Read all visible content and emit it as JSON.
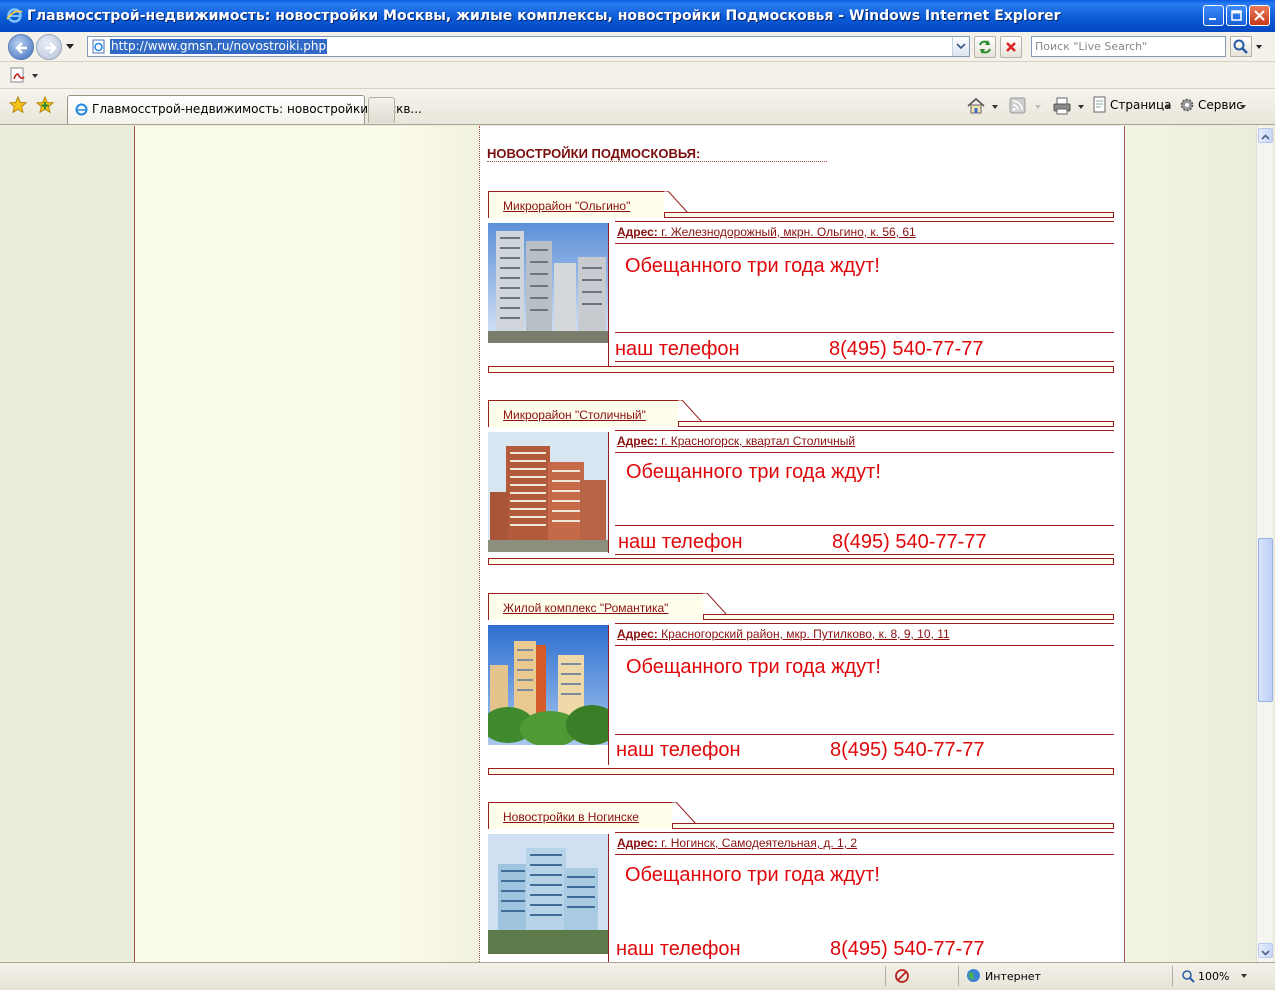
{
  "window": {
    "title": "Главмосстрой-недвижимость: новостройки Москвы, жилые комплексы, новостройки Подмосковья - Windows Internet Explorer"
  },
  "address_bar": {
    "url": "http://www.gmsn.ru/novostroiki.php"
  },
  "search": {
    "placeholder": "Поиск \"Live Search\""
  },
  "tabs": [
    {
      "label": "Главмосстрой-недвижимость: новостройки Москв..."
    }
  ],
  "command_bar": {
    "page_label": "Страница",
    "tools_label": "Сервис"
  },
  "content": {
    "section_title": "НОВОСТРОЙКИ ПОДМОСКОВЬЯ:",
    "listings": [
      {
        "name": "Микрорайон \"Ольгино\"",
        "address_label": "Адрес:",
        "address": "г. Железнодорожный, мкрн. Ольгино, к. 56, 61",
        "slogan": "Обещанного три года ждут!",
        "phone_label": "наш телефон",
        "phone": "8(495) 540-77-77"
      },
      {
        "name": "Микрорайон \"Столичный\"",
        "address_label": "Адрес:",
        "address": "г. Красногорск, квартал Столичный",
        "slogan": "Обещанного три года ждут!",
        "phone_label": "наш телефон",
        "phone": "8(495) 540-77-77"
      },
      {
        "name": "Жилой комплекс \"Романтика\"",
        "address_label": "Адрес:",
        "address": "Красногорский район, мкр. Путилково, к. 8, 9, 10, 11",
        "slogan": "Обещанного три года ждут!",
        "phone_label": "наш телефон",
        "phone": "8(495) 540-77-77"
      },
      {
        "name": "Новостройки в Ногинске",
        "address_label": "Адрес:",
        "address": "г. Ногинск, Самодеятельная, д. 1, 2",
        "slogan": "Обещанного три года ждут!",
        "phone_label": "наш телефон",
        "phone": "8(495) 540-77-77"
      }
    ]
  },
  "status_bar": {
    "zone": "Интернет",
    "zoom": "100%"
  },
  "icons": {
    "browser": "ie-logo-icon",
    "back": "back-arrow-icon",
    "forward": "forward-arrow-icon",
    "refresh": "refresh-icon",
    "stop": "stop-icon",
    "search": "search-icon",
    "favorites": "star-icon",
    "add_favorites": "add-star-icon",
    "home": "home-icon",
    "feeds": "rss-icon",
    "print": "print-icon",
    "page": "page-icon",
    "tools": "gear-icon",
    "pdf": "pdf-icon",
    "globe": "globe-icon"
  },
  "colors": {
    "titlebar": "#0a5de4",
    "accent_red": "#e0070a",
    "link_maroon": "#8a1010",
    "border_maroon": "#9b1d1d"
  }
}
